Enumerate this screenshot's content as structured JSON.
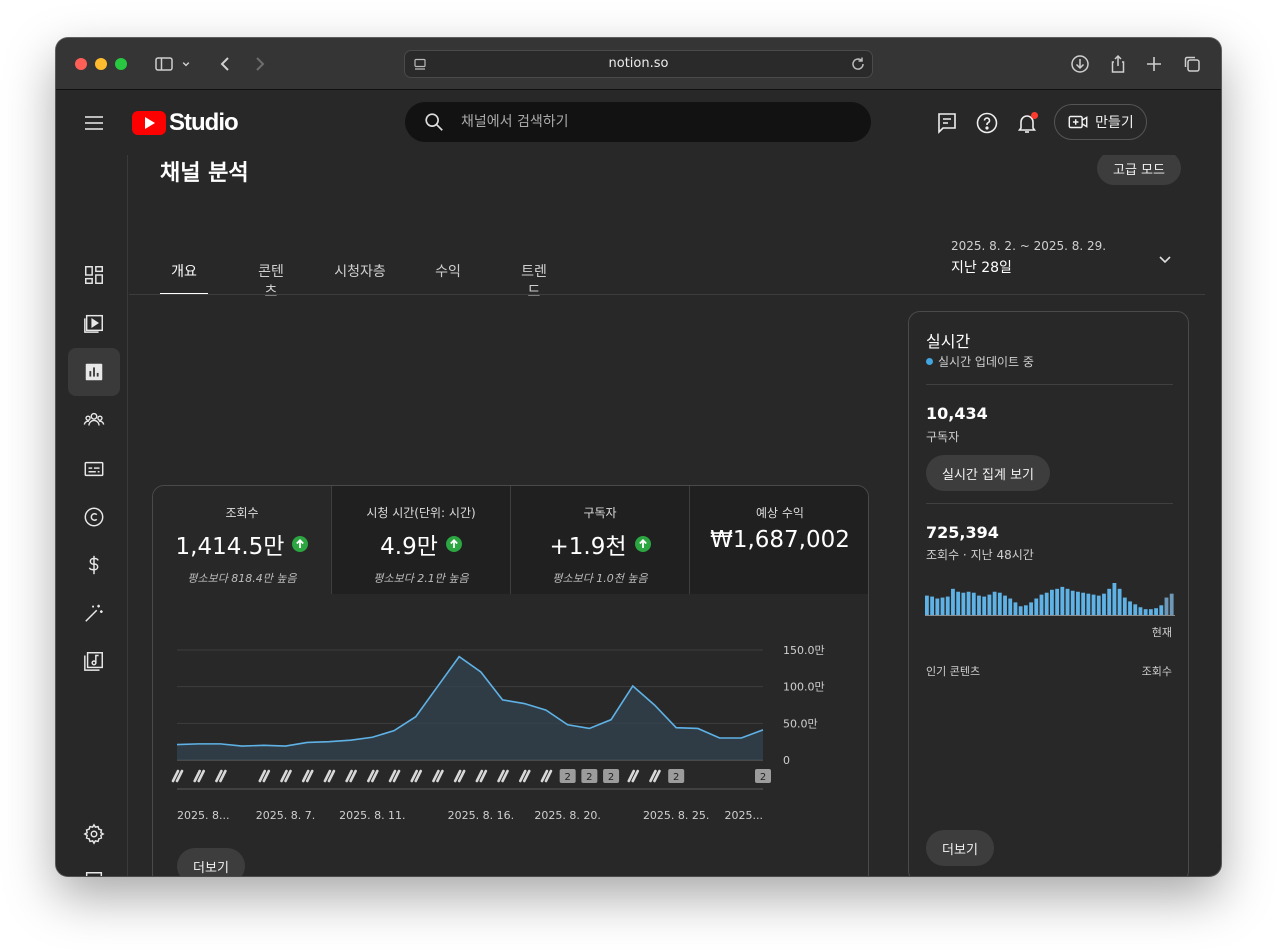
{
  "browser": {
    "url": "notion.so"
  },
  "header": {
    "logo_text": "Studio",
    "search_placeholder": "채널에서 검색하기",
    "create_label": "만들기"
  },
  "page": {
    "title": "채널 분석",
    "advanced_mode": "고급 모드",
    "tabs": [
      "개요",
      "콘텐츠",
      "시청자층",
      "수익",
      "트렌드"
    ],
    "active_tab": 0,
    "date_range": "2025. 8. 2. ~ 2025. 8. 29.",
    "date_label": "지난 28일"
  },
  "metrics": [
    {
      "label": "조회수",
      "value": "1,414.5만",
      "trend": "up",
      "note": "평소보다 818.4만 높음"
    },
    {
      "label": "시청 시간(단위: 시간)",
      "value": "4.9만",
      "trend": "up",
      "note": "평소보다 2.1만 높음"
    },
    {
      "label": "구독자",
      "value": "+1.9천",
      "trend": "up",
      "note": "평소보다 1.0천 높음"
    },
    {
      "label": "예상 수익",
      "value": "₩1,687,002",
      "trend": "none",
      "note": ""
    }
  ],
  "chart_data": {
    "type": "area",
    "x": [
      "2025. 8. 2.",
      "2025. 8. 3.",
      "2025. 8. 4.",
      "2025. 8. 5.",
      "2025. 8. 6.",
      "2025. 8. 7.",
      "2025. 8. 8.",
      "2025. 8. 9.",
      "2025. 8. 10.",
      "2025. 8. 11.",
      "2025. 8. 12.",
      "2025. 8. 13.",
      "2025. 8. 14.",
      "2025. 8. 15.",
      "2025. 8. 16.",
      "2025. 8. 17.",
      "2025. 8. 18.",
      "2025. 8. 19.",
      "2025. 8. 20.",
      "2025. 8. 21.",
      "2025. 8. 22.",
      "2025. 8. 23.",
      "2025. 8. 24.",
      "2025. 8. 25.",
      "2025. 8. 26.",
      "2025. 8. 27.",
      "2025. 8. 28.",
      "2025. 8. 29."
    ],
    "series": [
      {
        "values": [
          21,
          22,
          22,
          19,
          20,
          19,
          24,
          25,
          27,
          31,
          40,
          59,
          100,
          141,
          120,
          82,
          77,
          68,
          48,
          43,
          55,
          101,
          75,
          44,
          43,
          30,
          30,
          41
        ]
      }
    ],
    "ylim": [
      0,
      150
    ],
    "y_ticks": [
      "150.0만",
      "100.0만",
      "50.0만",
      "0"
    ],
    "x_tick_labels": [
      "2025. 8...",
      "2025. 8. 7.",
      "2025. 8. 11.",
      "2025. 8. 16.",
      "2025. 8. 20.",
      "2025. 8. 25.",
      "2025..."
    ],
    "x_tick_index": [
      0,
      5,
      9,
      14,
      18,
      23,
      27
    ],
    "markers": [
      "s",
      "s",
      "s",
      "",
      "s",
      "s",
      "s",
      "s",
      "s",
      "s",
      "s",
      "s",
      "s",
      "s",
      "s",
      "s",
      "s",
      "s",
      "2",
      "2",
      "2",
      "s",
      "s",
      "2",
      "",
      "",
      "",
      "2"
    ],
    "grid": true,
    "color": "#5fb2e6"
  },
  "more_label": "더보기",
  "realtime": {
    "title": "실시간",
    "live_text": "실시간 업데이트 중",
    "subscribers": "10,434",
    "subscribers_label": "구독자",
    "aggregate_button": "실시간 집계 보기",
    "views": "725,394",
    "views_label": "조회수 · 지난 48시간",
    "now_label": "현재",
    "top_content_label": "인기 콘텐츠",
    "top_content_col": "조회수",
    "more_label": "더보기",
    "hourly_views": [
      20,
      19,
      17,
      18,
      19,
      27,
      24,
      23,
      24,
      23,
      20,
      19,
      21,
      24,
      23,
      20,
      17,
      13,
      9,
      10,
      13,
      17,
      21,
      23,
      26,
      27,
      29,
      27,
      25,
      24,
      23,
      22,
      21,
      20,
      22,
      27,
      33,
      27,
      18,
      14,
      11,
      8,
      6,
      6,
      7,
      10,
      18,
      22
    ]
  },
  "colors": {
    "accent": "#5fb2e6",
    "up": "#2ba640",
    "brand": "#ff0000"
  }
}
